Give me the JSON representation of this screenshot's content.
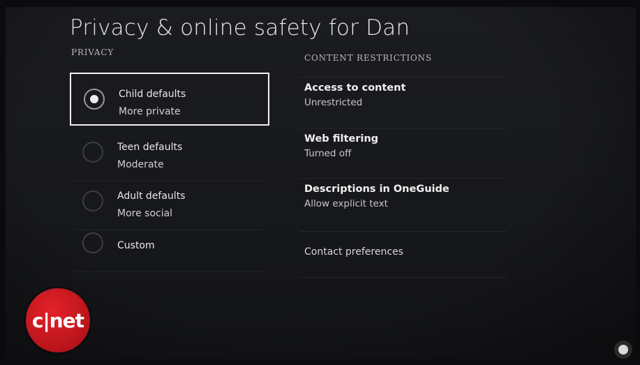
{
  "page": {
    "title": "Privacy & online safety for Dan"
  },
  "privacy": {
    "label": "PRIVACY",
    "options": [
      {
        "title": "Child defaults",
        "subtitle": "More private",
        "selected": true
      },
      {
        "title": "Teen defaults",
        "subtitle": "Moderate",
        "selected": false
      },
      {
        "title": "Adult defaults",
        "subtitle": "More social",
        "selected": false
      },
      {
        "title": "Custom",
        "subtitle": "",
        "selected": false
      }
    ]
  },
  "content_restrictions": {
    "label": "CONTENT RESTRICTIONS",
    "items": [
      {
        "title": "Access to content",
        "value": "Unrestricted"
      },
      {
        "title": "Web filtering",
        "value": "Turned off"
      },
      {
        "title": "Descriptions in OneGuide",
        "value": "Allow explicit text"
      }
    ],
    "contact_preferences": "Contact preferences"
  },
  "watermark": {
    "logo_text": "c|net",
    "corner_icon": "cnet-subscribe-icon"
  },
  "colors": {
    "background": "#17181b",
    "selection_border": "#f2f2f2",
    "logo_red": "#c8161d"
  }
}
